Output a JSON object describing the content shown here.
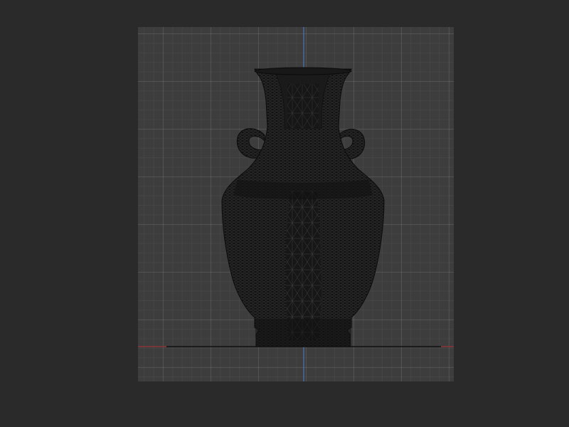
{
  "app": {
    "window_title": ""
  },
  "viewport": {
    "view": "front-orthographic",
    "display_mode": "wireframe",
    "grid": true,
    "axis_colors": {
      "vertical": "#4a7fd0",
      "horizontal": "#c8454a"
    },
    "background_color": "#3d3d3d",
    "grid_color": "#4a4a4a"
  },
  "model": {
    "object": "vase",
    "mesh_color": "#141414",
    "wire_color": "#3a3a3a"
  }
}
